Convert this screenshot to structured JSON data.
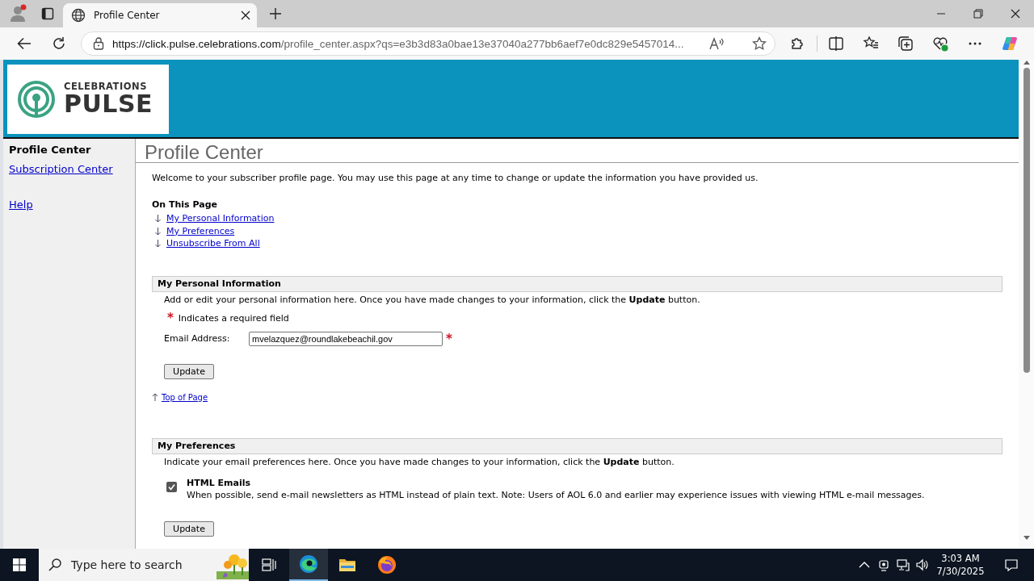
{
  "browser": {
    "tab_title": "Profile Center",
    "url_host": "https://click.pulse.celebrations.com",
    "url_path": "/profile_center.aspx?qs=e3b3d83a0bae13e37040a277bb6aef7e0dc829e5457014..."
  },
  "logo": {
    "line1": "CELEBRATIONS",
    "line2": "PULSE"
  },
  "sidebar": {
    "items": [
      {
        "label": "Profile Center",
        "kind": "current"
      },
      {
        "label": "Subscription Center",
        "kind": "link"
      },
      {
        "label": "Help",
        "kind": "link"
      }
    ]
  },
  "page_title": "Profile Center",
  "intro": "Welcome to your subscriber profile page. You may use this page at any time to change or update the information you have provided us.",
  "on_this_page": {
    "heading": "On This Page",
    "links": [
      "My Personal Information",
      "My Preferences",
      "Unsubscribe From All"
    ]
  },
  "personal": {
    "heading": "My Personal Information",
    "description": "Add or edit your personal information here. Once you have made changes to your information, click the **Update** button.",
    "required_mark": "*",
    "required_note": "Indicates a required field",
    "email_label": "Email Address:",
    "email_value": "mvelazquez@roundlakebeachil.gov",
    "email_required_mark": "*",
    "button": "Update",
    "top_link": "Top of Page"
  },
  "preferences": {
    "heading": "My Preferences",
    "description": "Indicate your email preferences here. Once you have made changes to your information, click the **Update** button.",
    "options": [
      {
        "label": "HTML Emails",
        "description": "When possible, send e-mail newsletters as HTML instead of plain text. Note: Users of AOL 6.0 and earlier may experience issues with viewing HTML e-mail messages.",
        "checked": true
      }
    ],
    "button": "Update"
  },
  "taskbar": {
    "search_placeholder": "Type here to search",
    "time": "3:03 AM",
    "date": "7/30/2025"
  }
}
